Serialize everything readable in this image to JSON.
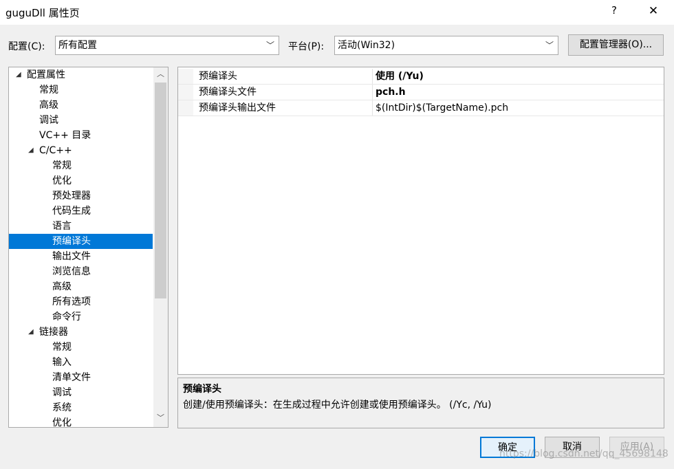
{
  "window": {
    "title": "guguDll 属性页",
    "help_label": "?",
    "close_label": "✕"
  },
  "toolbar": {
    "config_label": "配置(C):",
    "config_value": "所有配置",
    "platform_label": "平台(P):",
    "platform_value": "活动(Win32)",
    "manager_button": "配置管理器(O)..."
  },
  "tree": {
    "items": [
      {
        "label": "配置属性",
        "level": 0,
        "expanded": true
      },
      {
        "label": "常规",
        "level": 1
      },
      {
        "label": "高级",
        "level": 1
      },
      {
        "label": "调试",
        "level": 1
      },
      {
        "label": "VC++ 目录",
        "level": 1
      },
      {
        "label": "C/C++",
        "level": 1,
        "expanded": true
      },
      {
        "label": "常规",
        "level": 2
      },
      {
        "label": "优化",
        "level": 2
      },
      {
        "label": "预处理器",
        "level": 2
      },
      {
        "label": "代码生成",
        "level": 2
      },
      {
        "label": "语言",
        "level": 2
      },
      {
        "label": "预编译头",
        "level": 2,
        "selected": true
      },
      {
        "label": "输出文件",
        "level": 2
      },
      {
        "label": "浏览信息",
        "level": 2
      },
      {
        "label": "高级",
        "level": 2
      },
      {
        "label": "所有选项",
        "level": 2
      },
      {
        "label": "命令行",
        "level": 2
      },
      {
        "label": "链接器",
        "level": 1,
        "expanded": true
      },
      {
        "label": "常规",
        "level": 2
      },
      {
        "label": "输入",
        "level": 2
      },
      {
        "label": "清单文件",
        "level": 2
      },
      {
        "label": "调试",
        "level": 2
      },
      {
        "label": "系统",
        "level": 2
      },
      {
        "label": "优化",
        "level": 2
      }
    ]
  },
  "properties": [
    {
      "name": "预编译头",
      "value": "使用 (/Yu)",
      "bold": true
    },
    {
      "name": "预编译头文件",
      "value": "pch.h",
      "bold": true
    },
    {
      "name": "预编译头输出文件",
      "value": "$(IntDir)$(TargetName).pch",
      "bold": false
    }
  ],
  "description": {
    "title": "预编译头",
    "text": "创建/使用预编译头：在生成过程中允许创建或使用预编译头。     (/Yc, /Yu)"
  },
  "buttons": {
    "ok": "确定",
    "cancel": "取消",
    "apply": "应用(A)"
  },
  "watermark": "https://blog.csdn.net/qq_45698148",
  "colors": {
    "selection": "#0078d7",
    "window_bg": "#f0f0f0",
    "ok_border": "#0078d7"
  }
}
